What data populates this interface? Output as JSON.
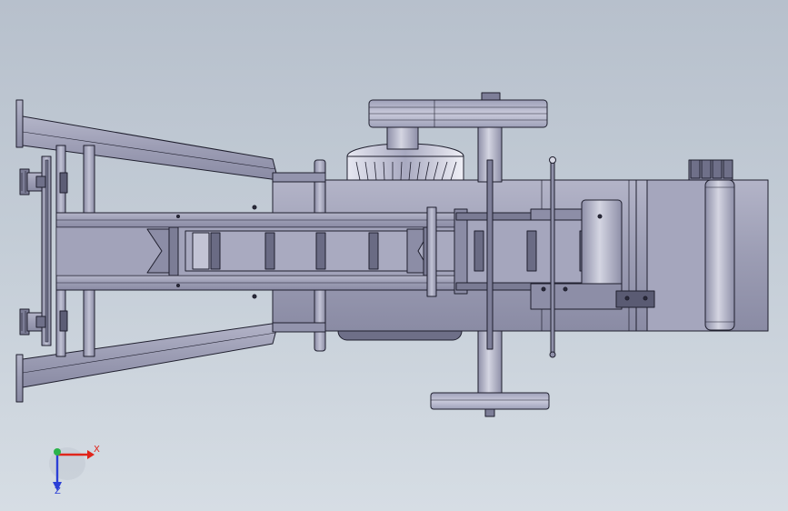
{
  "viewport": {
    "background_top": "#b7c0cc",
    "background_bottom": "#d6dde4",
    "part_fill": "#9a9bb3",
    "part_fill_light": "#b1b2c6",
    "part_fill_dark": "#7e7f99",
    "edge_color": "#1f1f2e"
  },
  "triad": {
    "x_label": "X",
    "z_label": "Z",
    "x_color": "#e0251b",
    "y_color": "#2bb34a",
    "z_color": "#2b3fd6"
  }
}
